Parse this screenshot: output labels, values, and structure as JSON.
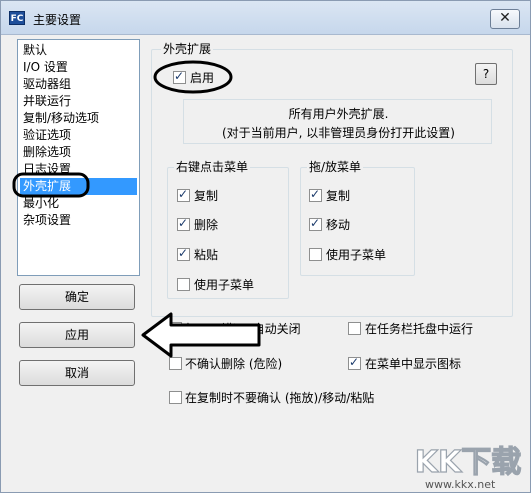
{
  "window": {
    "title": "主要设置",
    "app_icon_text": "FC",
    "close_glyph": "✕"
  },
  "sidebar": {
    "items": [
      {
        "label": "默认"
      },
      {
        "label": "I/O 设置"
      },
      {
        "label": "驱动器组"
      },
      {
        "label": "并联运行"
      },
      {
        "label": "复制/移动选项"
      },
      {
        "label": "验证选项"
      },
      {
        "label": "删除选项"
      },
      {
        "label": "日志设置"
      },
      {
        "label": "外壳扩展",
        "selected": true
      },
      {
        "label": "最小化"
      },
      {
        "label": "杂项设置"
      }
    ]
  },
  "buttons": {
    "ok": "确定",
    "apply": "应用",
    "cancel": "取消",
    "help": "?"
  },
  "shell_extension": {
    "group_label": "外壳扩展",
    "enable_label": "启用",
    "enable_checked": true,
    "info_line1": "所有用户外壳扩展.",
    "info_line2": "(对于当前用户, 以非管理员身份打开此设置)"
  },
  "right_click_menu": {
    "group_label": "右键点击菜单",
    "items": [
      {
        "label": "复制",
        "checked": true
      },
      {
        "label": "删除",
        "checked": true
      },
      {
        "label": "粘贴",
        "checked": true
      },
      {
        "label": "使用子菜单",
        "checked": false
      }
    ]
  },
  "drag_drop_menu": {
    "group_label": "拖/放菜单",
    "items": [
      {
        "label": "复制",
        "checked": true
      },
      {
        "label": "移动",
        "checked": true
      },
      {
        "label": "使用子菜单",
        "checked": false
      }
    ]
  },
  "options": {
    "auto_close": {
      "label": "如果无错误, 自动关闭",
      "checked": true
    },
    "tray": {
      "label": "在任务栏托盘中运行",
      "checked": false
    },
    "no_confirm_delete": {
      "label": "不确认删除 (危险)",
      "checked": false
    },
    "show_icon": {
      "label": "在菜单中显示图标",
      "checked": true
    },
    "no_confirm_copy": {
      "label": "在复制时不要确认 (拖放)/移动/粘贴",
      "checked": false
    }
  },
  "watermark": {
    "logo_text": "KK下载",
    "url": "www.kkx.net"
  },
  "colors": {
    "selection": "#3399ff",
    "annotation": "#000000"
  }
}
